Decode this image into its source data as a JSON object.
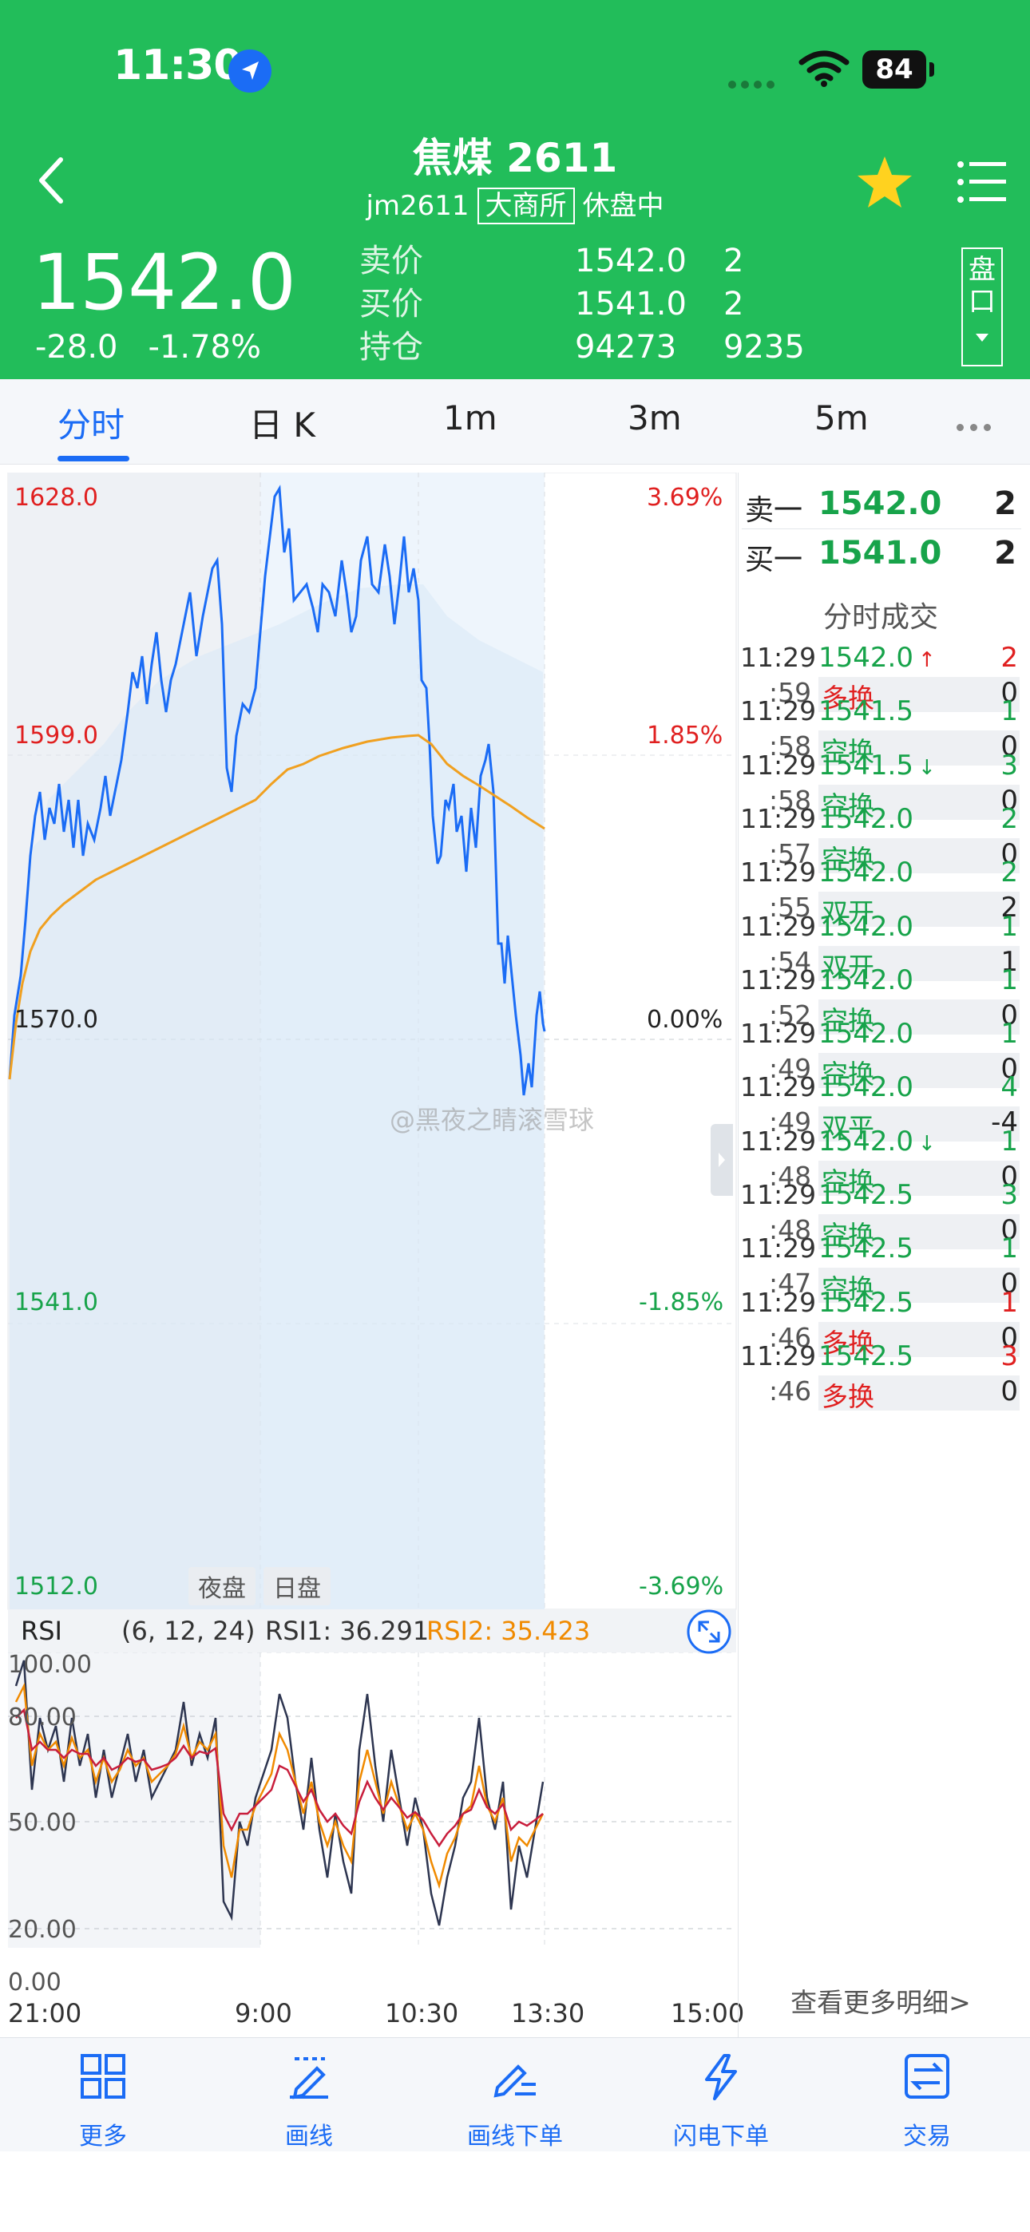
{
  "status_bar": {
    "time": "11:30",
    "battery": "84"
  },
  "header": {
    "title": "焦煤 2611",
    "symbol": "jm2611",
    "exchange": "大商所",
    "session_status": "休盘中",
    "price": "1542.0",
    "change": "-28.0",
    "change_pct": "-1.78%",
    "quote_labels": [
      "卖价",
      "买价",
      "持仓"
    ],
    "quote_values": [
      "1542.0",
      "1541.0",
      "94273"
    ],
    "quote_volumes": [
      "2",
      "2",
      "9235"
    ],
    "pankou_label": "盘口"
  },
  "tabs": [
    "分时",
    "日 K",
    "1m",
    "3m",
    "5m"
  ],
  "chart": {
    "price_labels": [
      "1628.0",
      "1599.0",
      "1570.0",
      "1541.0",
      "1512.0"
    ],
    "pct_labels": [
      "3.69%",
      "1.85%",
      "0.00%",
      "-1.85%",
      "-3.69%"
    ],
    "session_tags": [
      "夜盘",
      "日盘"
    ],
    "watermark": "@黑夜之睛滚雪球",
    "time_labels": [
      "21:00",
      "9:00",
      "10:30",
      "13:30",
      "15:00"
    ]
  },
  "rsi": {
    "label": "RSI",
    "params": "(6, 12, 24)",
    "rsi1": "RSI1: 36.291",
    "rsi2": "RSI2: 35.423",
    "axis": [
      "100.00",
      "80.00",
      "50.00",
      "20.00",
      "0.00"
    ]
  },
  "orderbook": {
    "ask_label": "卖一",
    "ask_price": "1542.0",
    "ask_vol": "2",
    "bid_label": "买一",
    "bid_price": "1541.0",
    "bid_vol": "2",
    "title": "分时成交",
    "more": "查看更多明细>",
    "trades": [
      {
        "hm": "11:29",
        "sec": ":59",
        "price": "1542.0",
        "arrow": "↑",
        "vol": "2",
        "kind": "多换",
        "delta": "0",
        "vol_color": "#e02020",
        "kind_color": "#e02020"
      },
      {
        "hm": "11:29",
        "sec": ":58",
        "price": "1541.5",
        "arrow": "",
        "vol": "1",
        "kind": "空换",
        "delta": "0",
        "vol_color": "#17a34a",
        "kind_color": "#17a34a"
      },
      {
        "hm": "11:29",
        "sec": ":58",
        "price": "1541.5",
        "arrow": "↓",
        "vol": "3",
        "kind": "空换",
        "delta": "0",
        "vol_color": "#17a34a",
        "kind_color": "#17a34a"
      },
      {
        "hm": "11:29",
        "sec": ":57",
        "price": "1542.0",
        "arrow": "",
        "vol": "2",
        "kind": "空换",
        "delta": "0",
        "vol_color": "#17a34a",
        "kind_color": "#17a34a"
      },
      {
        "hm": "11:29",
        "sec": ":55",
        "price": "1542.0",
        "arrow": "",
        "vol": "2",
        "kind": "双开",
        "delta": "2",
        "vol_color": "#17a34a",
        "kind_color": "#17a34a"
      },
      {
        "hm": "11:29",
        "sec": ":54",
        "price": "1542.0",
        "arrow": "",
        "vol": "1",
        "kind": "双开",
        "delta": "1",
        "vol_color": "#17a34a",
        "kind_color": "#17a34a"
      },
      {
        "hm": "11:29",
        "sec": ":52",
        "price": "1542.0",
        "arrow": "",
        "vol": "1",
        "kind": "空换",
        "delta": "0",
        "vol_color": "#17a34a",
        "kind_color": "#17a34a"
      },
      {
        "hm": "11:29",
        "sec": ":49",
        "price": "1542.0",
        "arrow": "",
        "vol": "1",
        "kind": "空换",
        "delta": "0",
        "vol_color": "#17a34a",
        "kind_color": "#17a34a"
      },
      {
        "hm": "11:29",
        "sec": ":49",
        "price": "1542.0",
        "arrow": "",
        "vol": "4",
        "kind": "双平",
        "delta": "-4",
        "vol_color": "#17a34a",
        "kind_color": "#17a34a"
      },
      {
        "hm": "11:29",
        "sec": ":48",
        "price": "1542.0",
        "arrow": "↓",
        "vol": "1",
        "kind": "空换",
        "delta": "0",
        "vol_color": "#17a34a",
        "kind_color": "#17a34a"
      },
      {
        "hm": "11:29",
        "sec": ":48",
        "price": "1542.5",
        "arrow": "",
        "vol": "3",
        "kind": "空换",
        "delta": "0",
        "vol_color": "#17a34a",
        "kind_color": "#17a34a"
      },
      {
        "hm": "11:29",
        "sec": ":47",
        "price": "1542.5",
        "arrow": "",
        "vol": "1",
        "kind": "空换",
        "delta": "0",
        "vol_color": "#17a34a",
        "kind_color": "#17a34a"
      },
      {
        "hm": "11:29",
        "sec": ":46",
        "price": "1542.5",
        "arrow": "",
        "vol": "1",
        "kind": "多换",
        "delta": "0",
        "vol_color": "#e02020",
        "kind_color": "#e02020"
      },
      {
        "hm": "11:29",
        "sec": ":46",
        "price": "1542.5",
        "arrow": "",
        "vol": "3",
        "kind": "多换",
        "delta": "0",
        "vol_color": "#e02020",
        "kind_color": "#e02020"
      }
    ]
  },
  "bottom_nav": [
    "更多",
    "画线",
    "画线下单",
    "闪电下单",
    "交易"
  ],
  "colors": {
    "brand_green": "#22bd5a",
    "accent_blue": "#1b6cf5",
    "up_red": "#e02020",
    "down_green": "#17a34a",
    "avg_line": "#f0a020"
  }
}
